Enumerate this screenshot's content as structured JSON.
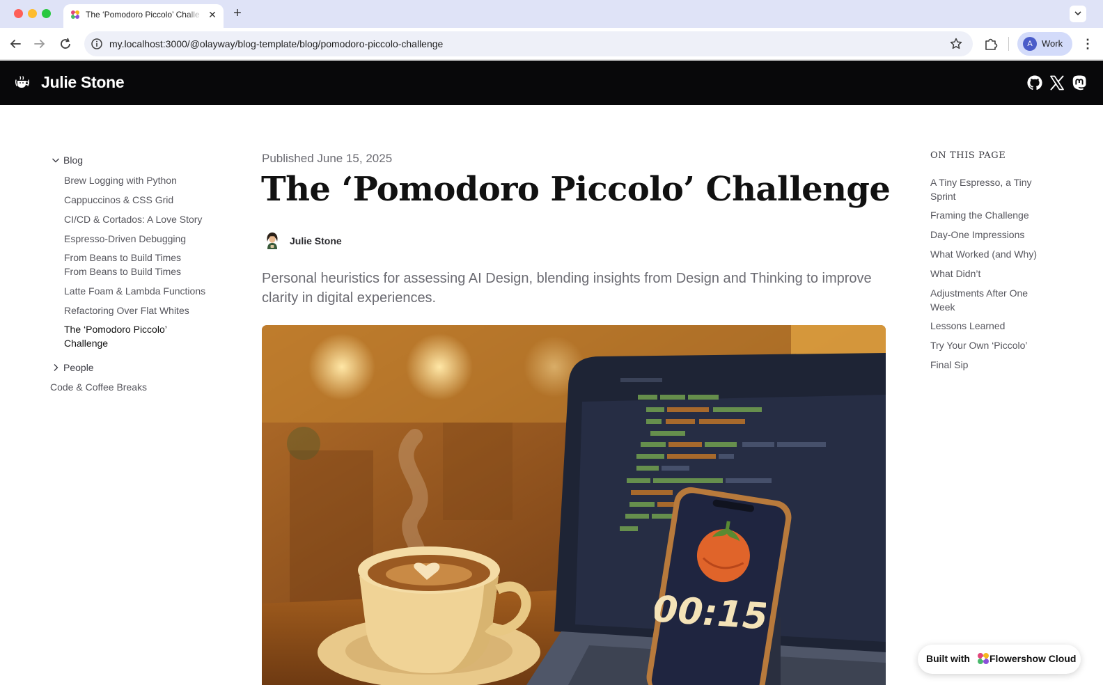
{
  "browser": {
    "tab_title": "The ‘Pomodoro Piccolo’ Challenge",
    "new_tab_label": "+",
    "url": "my.localhost:3000/@olayway/blog-template/blog/pomodoro-piccolo-challenge",
    "profile_initial": "A",
    "profile_label": "Work"
  },
  "site": {
    "title": "Julie Stone",
    "social_icons": [
      "github-icon",
      "x-icon",
      "mastodon-icon"
    ]
  },
  "sidebar": {
    "folder_blog": "Blog",
    "blog_items": [
      "Brew Logging with Python",
      "Cappuccinos & CSS Grid",
      "CI/CD & Cortados: A Love Story",
      "Espresso-Driven Debugging",
      "From Beans to Build Times From Beans to Build Times",
      "Latte Foam & Lambda Functions",
      "Refactoring Over Flat Whites",
      "The ‘Pomodoro Piccolo’ Challenge"
    ],
    "folder_people": "People",
    "root_item": "Code & Coffee Breaks"
  },
  "article": {
    "published": "Published June 15, 2025",
    "title": "The ‘Pomodoro Piccolo’ Challenge",
    "author": "Julie Stone",
    "lead": "Personal heuristics for assessing AI Design, blending insights from Design and Thinking to improve clarity in digital experiences.",
    "hero_timer": "00:15"
  },
  "toc": {
    "title": "ON THIS PAGE",
    "items": [
      "A Tiny Espresso, a Tiny Sprint",
      "Framing the Challenge",
      "Day-One Impressions",
      "What Worked (and Why)",
      "What Didn’t",
      "Adjustments After One Week",
      "Lessons Learned",
      "Try Your Own ‘Piccolo’",
      "Final Sip"
    ]
  },
  "badge": {
    "prefix": "Built with",
    "brand": "Flowershow Cloud"
  },
  "colors": {
    "header_bg": "#08080a",
    "tabbar_bg": "#dfe3f7",
    "profile_bg": "#d3dbfa"
  }
}
